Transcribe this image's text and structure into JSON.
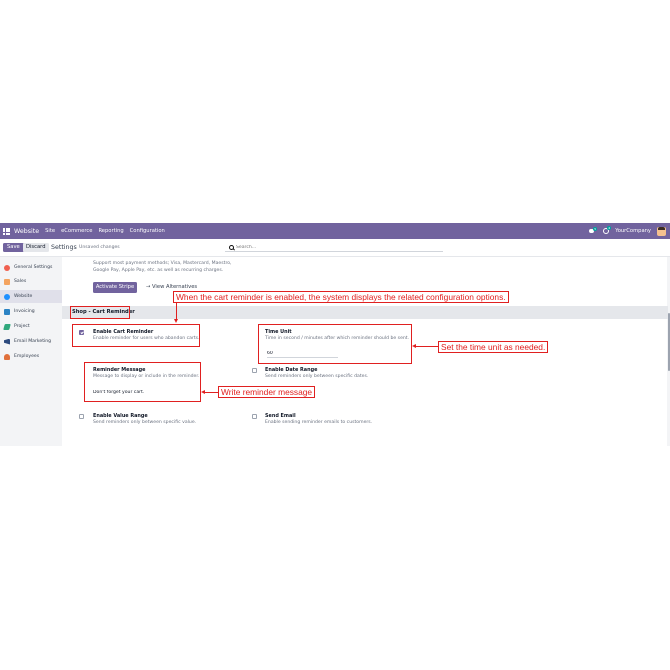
{
  "navbar": {
    "app_name": "Website",
    "menu": [
      "Site",
      "eCommerce",
      "Reporting",
      "Configuration"
    ],
    "chat_badge": "5",
    "activity_badge": "4",
    "company": "YourCompany"
  },
  "control_panel": {
    "save_label": "Save",
    "discard_label": "Discard",
    "title": "Settings",
    "unsaved": "Unsaved changes",
    "search_placeholder": "Search..."
  },
  "sidebar": {
    "items": [
      {
        "label": "General Settings",
        "color": "#f06050",
        "active": false
      },
      {
        "label": "Sales",
        "color": "#f4a460",
        "active": false
      },
      {
        "label": "Website",
        "color": "#1e90ff",
        "active": true
      },
      {
        "label": "Invoicing",
        "color": "#2b83c4",
        "active": false
      },
      {
        "label": "Project",
        "color": "#30a87c",
        "active": false
      },
      {
        "label": "Email Marketing",
        "color": "#2c4a7e",
        "active": false
      },
      {
        "label": "Employees",
        "color": "#e0703c",
        "active": false
      }
    ]
  },
  "payment": {
    "line1": "Support most payment methods; Visa, Mastercard, Maestro,",
    "line2": "Google Pay, Apple Pay, etc. as well as recurring charges.",
    "activate_label": "Activate Stripe",
    "alternatives_label": "→ View Alternatives"
  },
  "section": {
    "title": "Shop - Cart Reminder"
  },
  "settings": {
    "enable_cart": {
      "title": "Enable Cart Reminder",
      "desc": "Enable reminder for users who abandon carts.",
      "checked": true
    },
    "time_unit": {
      "title": "Time Unit",
      "desc": "Time in second / minutes after which reminder should be sent.",
      "value": "60"
    },
    "reminder_message": {
      "title": "Reminder Message",
      "desc": "Message to display or include in the reminder.",
      "value": "Don't forget your cart."
    },
    "date_range": {
      "title": "Enable Date Range",
      "desc": "Send reminders only between specific dates.",
      "checked": false
    },
    "value_range": {
      "title": "Enable Value Range",
      "desc": "Send reminders only between specific value.",
      "checked": false
    },
    "send_email": {
      "title": "Send Email",
      "desc": "Enable sending reminder emails to customers.",
      "checked": false
    }
  },
  "annotations": {
    "top": "When the cart reminder is enabled, the system displays the related configuration options.",
    "time_unit": "Set the time unit as needed.",
    "message": "Write reminder message"
  },
  "colors": {
    "brand": "#71639e",
    "annotation": "#e02020"
  }
}
